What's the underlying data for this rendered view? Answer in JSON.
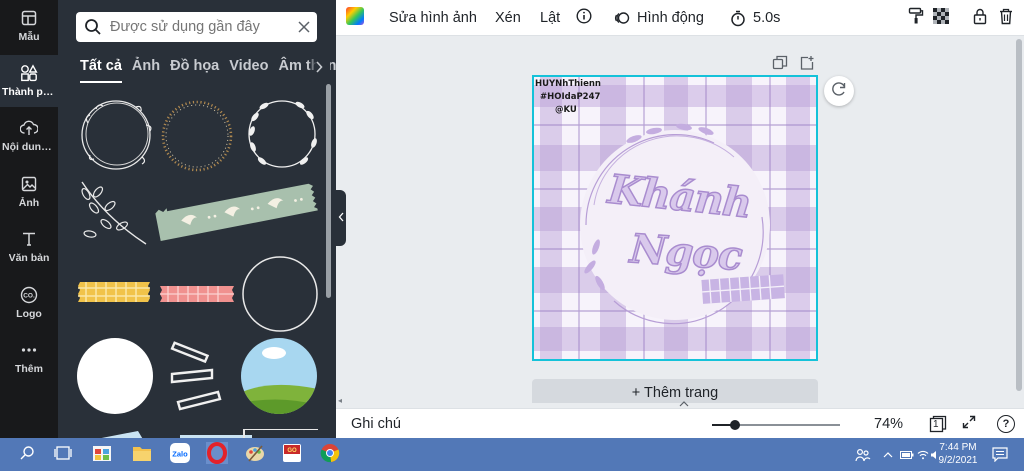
{
  "sidebar": {
    "items": [
      {
        "label": "Mẫu",
        "icon": "template-icon"
      },
      {
        "label": "Thành phần",
        "icon": "elements-icon"
      },
      {
        "label": "Nội dung tải lên",
        "icon": "upload-icon"
      },
      {
        "label": "Ảnh",
        "icon": "photo-icon"
      },
      {
        "label": "Văn bản",
        "icon": "text-icon"
      },
      {
        "label": "Logo",
        "icon": "logo-icon"
      },
      {
        "label": "Thêm",
        "icon": "more-icon"
      }
    ],
    "active_index": 1
  },
  "panel": {
    "search": {
      "placeholder": "Được sử dụng gần đây",
      "value": ""
    },
    "tabs": [
      "Tất cả",
      "Ảnh",
      "Đồ họa",
      "Video",
      "Âm thanh"
    ],
    "active_tab": 0,
    "elements": [
      "floral-wreath-outline",
      "beaded-wreath",
      "leafy-wreath",
      "branch-sprig",
      "washi-tape-birds",
      "washi-tape-yellow-plaid",
      "washi-tape-pink-plaid",
      "circle-outline-frame",
      "white-circle",
      "torn-tape-strips",
      "landscape-circle-frame"
    ]
  },
  "toolbar": {
    "edit_image": "Sửa hình ảnh",
    "crop": "Xén",
    "flip": "Lật",
    "animate": "Hình động",
    "duration": "5.0s"
  },
  "canvas": {
    "add_page": "+ Thêm trang",
    "design": {
      "watermark_lines": [
        "HUYNhThienn",
        "#HOIdaP247",
        "@KU"
      ],
      "title_lines": [
        "Khánh",
        "Ngọc"
      ],
      "colors": {
        "plaid": "#b79ed6",
        "plaid_light": "#e5dcef",
        "accent": "#9b7fc4",
        "selection": "#14c2d9"
      }
    }
  },
  "bottombar": {
    "notes": "Ghi chú",
    "zoom": "74%",
    "zoom_fraction": 0.18,
    "page_count": "1",
    "help": "?"
  },
  "taskbar": {
    "time": "7:44 PM",
    "date": "9/2/2021",
    "apps": [
      "search-icon",
      "task-view-icon",
      "store-icon",
      "file-explorer-icon",
      "zalo-icon",
      "opera-icon",
      "paint-icon",
      "game-icon",
      "chrome-icon"
    ]
  }
}
